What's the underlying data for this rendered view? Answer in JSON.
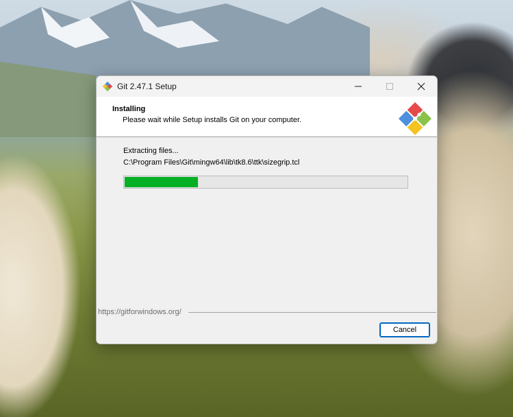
{
  "window": {
    "title": "Git 2.47.1 Setup"
  },
  "header": {
    "title": "Installing",
    "subtitle": "Please wait while Setup installs Git on your computer."
  },
  "progress": {
    "status": "Extracting files...",
    "current_file": "C:\\Program Files\\Git\\mingw64\\lib\\tk8.6\\ttk\\sizegrip.tcl",
    "fraction": 0.26
  },
  "footer": {
    "link": "https://gitforwindows.org/",
    "cancel_label": "Cancel"
  },
  "icons": {
    "app": "git-icon",
    "logo": "git-logo",
    "minimize": "minimize-icon",
    "maximize": "maximize-icon",
    "close": "close-icon"
  },
  "colors": {
    "progress": "#06b025",
    "focus_border": "#0067c0"
  }
}
